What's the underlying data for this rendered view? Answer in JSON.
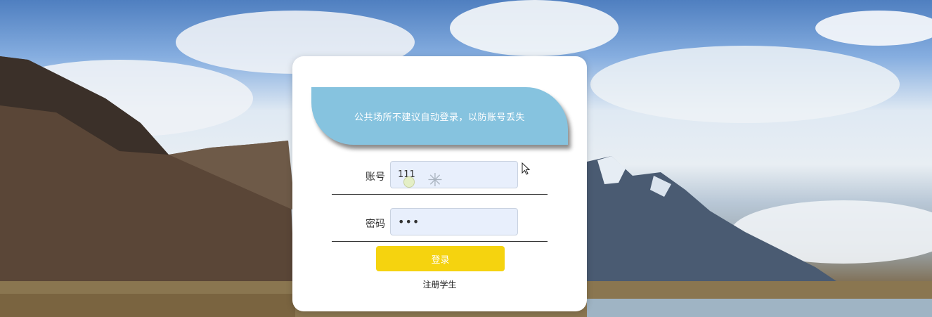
{
  "notice": {
    "text": "公共场所不建议自动登录，以防账号丢失"
  },
  "form": {
    "username_label": "账号",
    "username_value": "111",
    "password_label": "密码",
    "password_value": "•••",
    "login_label": "登录",
    "register_label": "注册学生"
  },
  "icons": {
    "cursor": "mouse-pointer-icon",
    "loading": "loading-spinner-icon"
  },
  "colors": {
    "notice_bg": "#86c3df",
    "button_bg": "#f5d30f",
    "input_bg": "#e8effc"
  }
}
